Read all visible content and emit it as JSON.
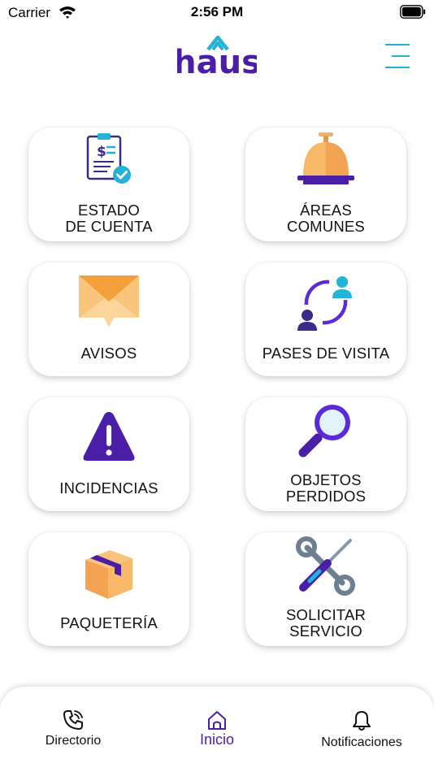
{
  "status_bar": {
    "carrier": "Carrier",
    "time": "2:56 PM"
  },
  "header": {
    "logo_text": "haus",
    "brand_color": "#4a1ea6",
    "accent_color": "#22b3d6"
  },
  "tiles": [
    {
      "line1": "ESTADO",
      "line2": "DE CUENTA",
      "icon": "clipboard-invoice-icon"
    },
    {
      "line1": "ÁREAS",
      "line2": "COMUNES",
      "icon": "service-bell-icon"
    },
    {
      "line1": "AVISOS",
      "line2": "",
      "icon": "envelope-icon"
    },
    {
      "line1": "PASES DE VISITA",
      "line2": "",
      "icon": "visitor-exchange-icon"
    },
    {
      "line1": "INCIDENCIAS",
      "line2": "",
      "icon": "warning-icon"
    },
    {
      "line1": "OBJETOS",
      "line2": "PERDIDOS",
      "icon": "magnifier-icon"
    },
    {
      "line1": "PAQUETERÍA",
      "line2": "",
      "icon": "package-icon"
    },
    {
      "line1": "SOLICITAR",
      "line2": "SERVICIO",
      "icon": "tools-icon"
    }
  ],
  "bottom_nav": {
    "items": [
      {
        "label": "Directorio",
        "icon": "phone-icon",
        "active": false
      },
      {
        "label": "Inicio",
        "icon": "home-icon",
        "active": true
      },
      {
        "label": "Notificaciones",
        "icon": "bell-icon",
        "active": false
      }
    ]
  }
}
